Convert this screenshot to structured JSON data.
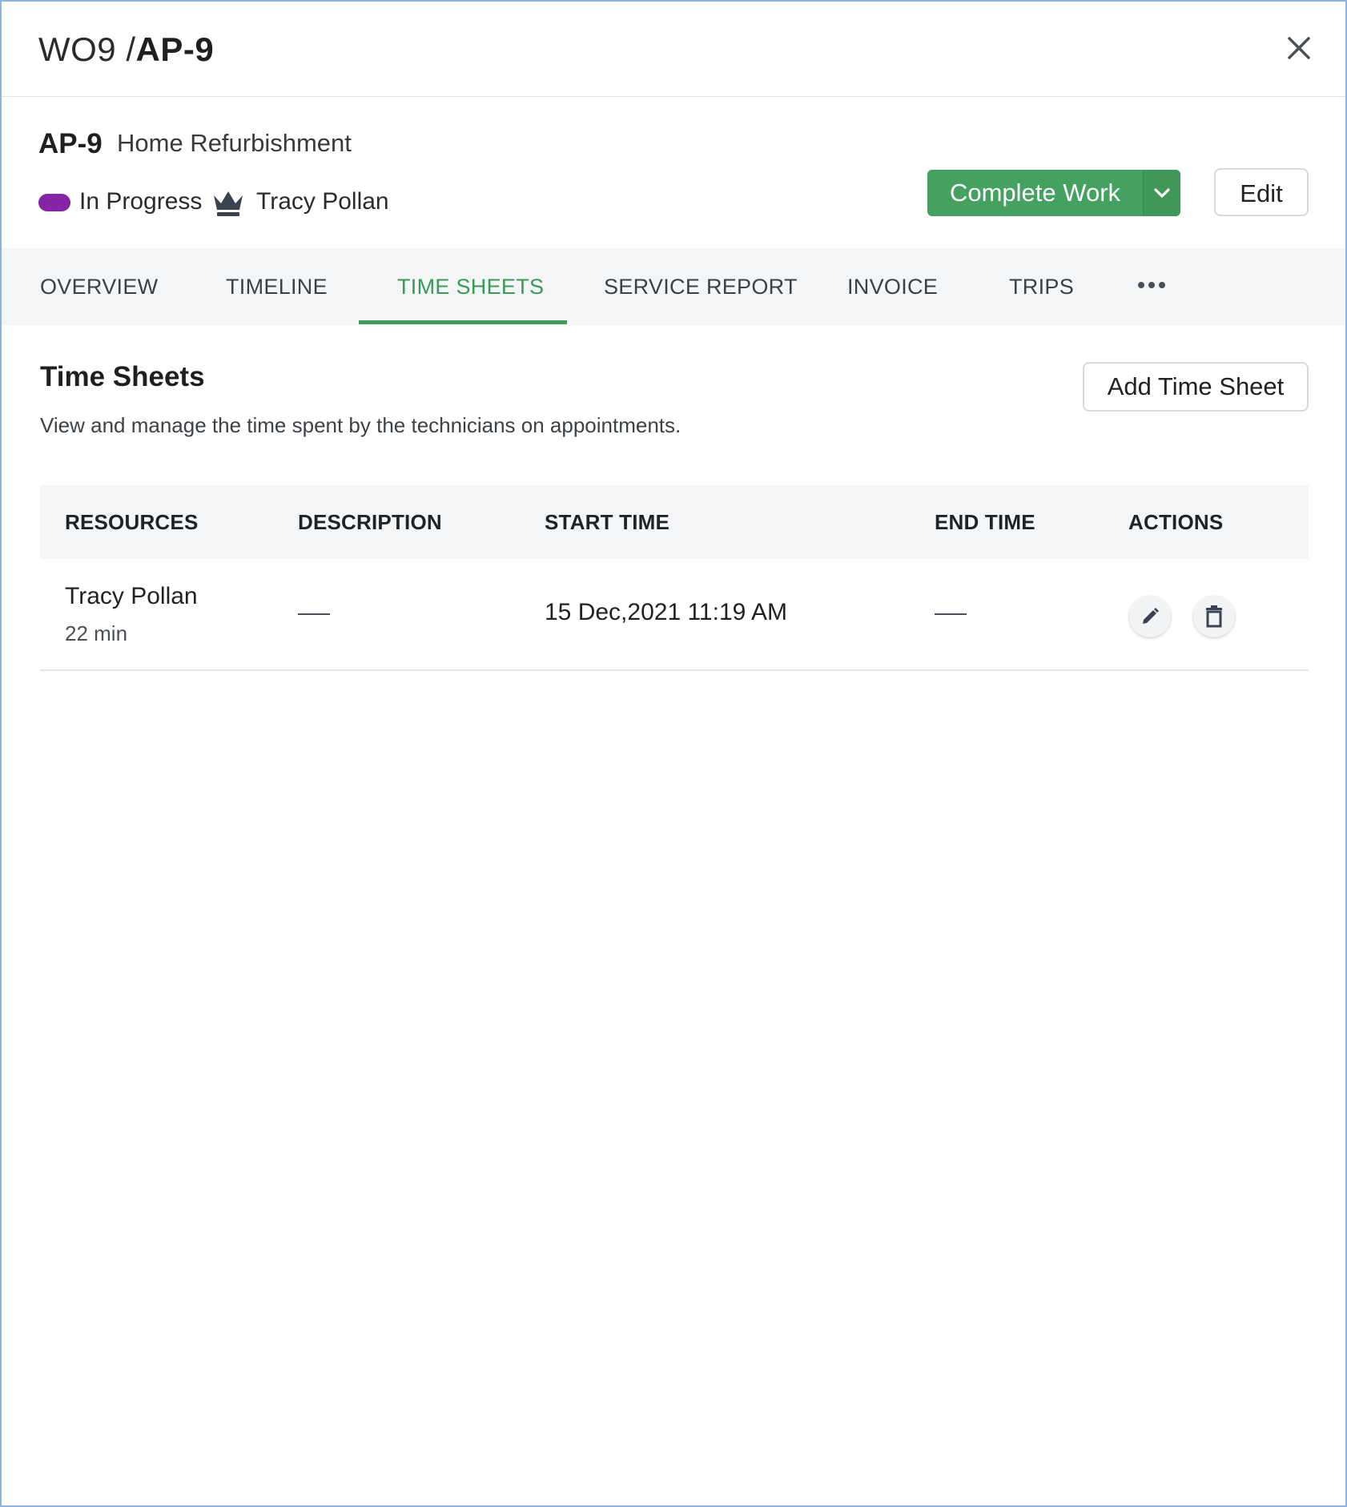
{
  "header": {
    "crumb_lead": "WO9 /",
    "crumb_current": "AP-9"
  },
  "appointment": {
    "id": "AP-9",
    "name": "Home Refurbishment",
    "status": "In Progress",
    "status_color": "#8624a6",
    "owner": "Tracy Pollan"
  },
  "actions": {
    "complete_label": "Complete Work",
    "edit_label": "Edit",
    "accent": "#45a160"
  },
  "tabs": [
    {
      "label": "OVERVIEW",
      "active": false
    },
    {
      "label": "TIMELINE",
      "active": false
    },
    {
      "label": "TIME SHEETS",
      "active": true
    },
    {
      "label": "SERVICE REPORT",
      "active": false
    },
    {
      "label": "INVOICE",
      "active": false
    },
    {
      "label": "TRIPS",
      "active": false
    }
  ],
  "section": {
    "title": "Time Sheets",
    "description": "View and manage the time spent by the technicians on appointments.",
    "add_label": "Add Time Sheet"
  },
  "table": {
    "columns": [
      "RESOURCES",
      "DESCRIPTION",
      "START TIME",
      "END TIME",
      "ACTIONS"
    ],
    "rows": [
      {
        "resource": "Tracy Pollan",
        "duration": "22 min",
        "description": "—",
        "start_time": "15 Dec,2021 11:19 AM",
        "end_time": "—"
      }
    ]
  },
  "icons": {
    "close": "close-icon",
    "caret": "chevron-down-icon",
    "owner": "crown-icon",
    "more": "more-horizontal-icon",
    "edit": "pencil-icon",
    "delete": "trash-icon"
  }
}
